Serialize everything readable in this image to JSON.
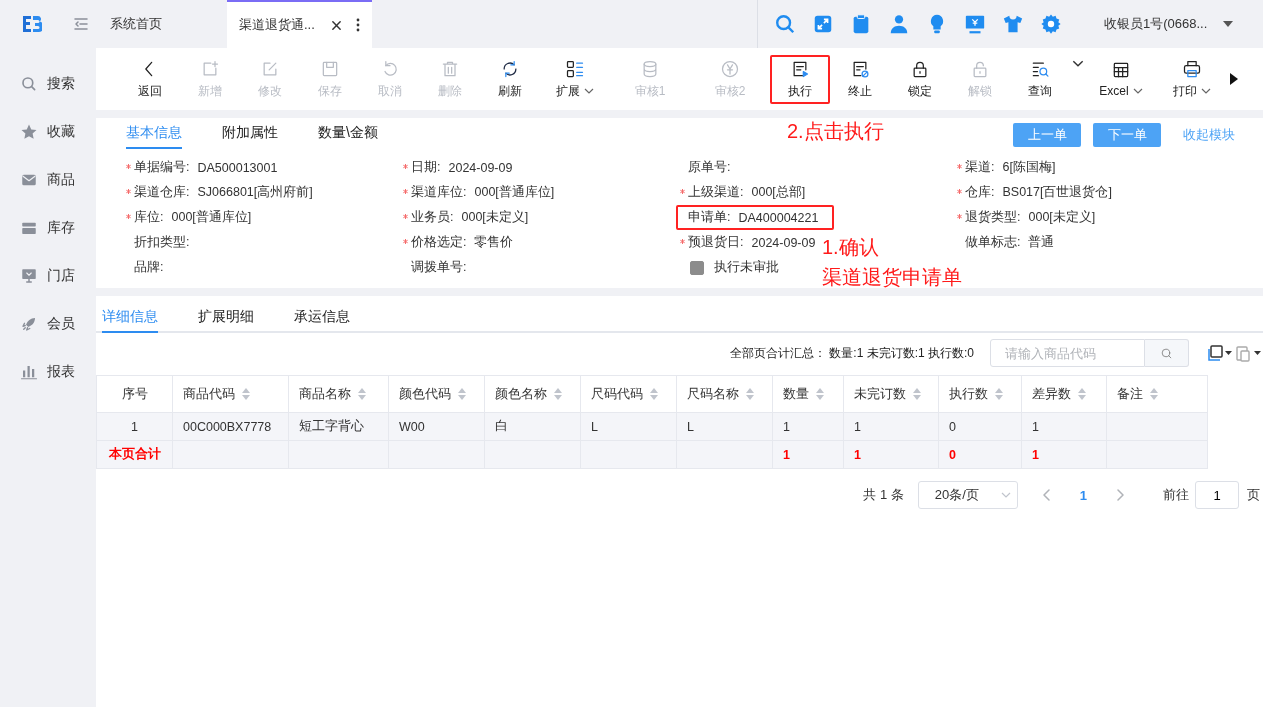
{
  "header": {
    "tabs": [
      {
        "label": "系统首页",
        "selected": false,
        "closable": false
      },
      {
        "label": "渠道退货通...",
        "selected": true,
        "closable": true
      }
    ],
    "user": "收银员1号(0668..."
  },
  "sidebar": {
    "items": [
      {
        "label": "搜索"
      },
      {
        "label": "收藏"
      },
      {
        "label": "商品"
      },
      {
        "label": "库存"
      },
      {
        "label": "门店"
      },
      {
        "label": "会员"
      },
      {
        "label": "报表"
      }
    ]
  },
  "toolbar": [
    {
      "kind": "button",
      "label": "返回",
      "disabled": false,
      "dropdown": false,
      "annotated": false
    },
    {
      "kind": "button",
      "label": "新增",
      "disabled": true,
      "dropdown": false,
      "annotated": false
    },
    {
      "kind": "button",
      "label": "修改",
      "disabled": true,
      "dropdown": false,
      "annotated": false
    },
    {
      "kind": "button",
      "label": "保存",
      "disabled": true,
      "dropdown": false,
      "annotated": false
    },
    {
      "kind": "button",
      "label": "取消",
      "disabled": true,
      "dropdown": false,
      "annotated": false
    },
    {
      "kind": "button",
      "label": "删除",
      "disabled": true,
      "dropdown": false,
      "annotated": false
    },
    {
      "kind": "button",
      "label": "刷新",
      "disabled": false,
      "dropdown": false,
      "annotated": false
    },
    {
      "kind": "button",
      "label": "扩展",
      "disabled": false,
      "dropdown": true,
      "annotated": false
    },
    {
      "kind": "button",
      "label": "审核1",
      "disabled": true,
      "dropdown": false,
      "annotated": false
    },
    {
      "kind": "button",
      "label": "审核2",
      "disabled": true,
      "dropdown": false,
      "annotated": false
    },
    {
      "kind": "button",
      "label": "执行",
      "disabled": false,
      "dropdown": false,
      "annotated": true
    },
    {
      "kind": "button",
      "label": "终止",
      "disabled": false,
      "dropdown": false,
      "annotated": false
    },
    {
      "kind": "button",
      "label": "锁定",
      "disabled": false,
      "dropdown": false,
      "annotated": false
    },
    {
      "kind": "button",
      "label": "解锁",
      "disabled": true,
      "dropdown": false,
      "annotated": false
    },
    {
      "kind": "button",
      "label": "查询",
      "disabled": false,
      "dropdown": false,
      "annotated": false
    },
    {
      "kind": "caret",
      "disabled": false
    },
    {
      "kind": "button",
      "label": "Excel",
      "disabled": false,
      "dropdown": true,
      "annotated": false
    },
    {
      "kind": "button",
      "label": "打印",
      "disabled": false,
      "dropdown": true,
      "annotated": false
    }
  ],
  "form": {
    "tabs": [
      {
        "label": "基本信息",
        "selected": true
      },
      {
        "label": "附加属性",
        "selected": false
      },
      {
        "label": "数量\\金额",
        "selected": false
      }
    ],
    "nav_buttons": [
      "上一单",
      "下一单"
    ],
    "collapse_link": "收起模块",
    "fields": [
      {
        "kind": "field",
        "label": "单据编号:",
        "value": "DA500013001",
        "required": true,
        "annotated": false
      },
      {
        "kind": "field",
        "label": "日期:",
        "value": "2024-09-09",
        "required": true,
        "annotated": false
      },
      {
        "kind": "field",
        "label": "原单号:",
        "required": false,
        "annotated": false
      },
      {
        "kind": "field",
        "label": "渠道:",
        "value": "6[陈国梅]",
        "required": true,
        "annotated": false
      },
      {
        "kind": "field",
        "label": "渠道仓库:",
        "value": "SJ066801[高州府前]",
        "required": true,
        "annotated": false
      },
      {
        "kind": "field",
        "label": "渠道库位:",
        "value": "000[普通库位]",
        "required": true,
        "annotated": false
      },
      {
        "kind": "field",
        "label": "上级渠道:",
        "value": "000[总部]",
        "required": true,
        "annotated": false
      },
      {
        "kind": "field",
        "label": "仓库:",
        "value": "BS017[百世退货仓]",
        "required": true,
        "annotated": false
      },
      {
        "kind": "field",
        "label": "库位:",
        "value": "000[普通库位]",
        "required": true,
        "annotated": false
      },
      {
        "kind": "field",
        "label": "业务员:",
        "value": "000[未定义]",
        "required": true,
        "annotated": false
      },
      {
        "kind": "field",
        "label": "申请单:",
        "value": "DA400004221",
        "required": false,
        "annotated": true
      },
      {
        "kind": "field",
        "label": "退货类型:",
        "value": "000[未定义]",
        "required": true,
        "annotated": false
      },
      {
        "kind": "field",
        "label": "折扣类型:",
        "required": false,
        "annotated": false
      },
      {
        "kind": "field",
        "label": "价格选定:",
        "value": "零售价",
        "required": true,
        "annotated": false
      },
      {
        "kind": "field",
        "label": "预退货日:",
        "value": "2024-09-09",
        "required": true,
        "annotated": false
      },
      {
        "kind": "field",
        "label": "做单标志:",
        "value": "普通",
        "required": false,
        "annotated": false
      },
      {
        "kind": "field",
        "label": "品牌:",
        "required": false,
        "annotated": false
      },
      {
        "kind": "field",
        "label": "调拨单号:",
        "required": false,
        "annotated": false
      },
      {
        "kind": "checkbox",
        "label": "执行未审批",
        "checked": false,
        "disabled": true
      }
    ]
  },
  "detail": {
    "tabs": [
      {
        "label": "详细信息",
        "selected": true
      },
      {
        "label": "扩展明细",
        "selected": false
      },
      {
        "label": "承运信息",
        "selected": false
      }
    ],
    "summary": "全部页合计汇总： 数量:1 未完订数:1 执行数:0",
    "search": {
      "placeholder": "请输入商品代码"
    },
    "table": {
      "columns": [
        {
          "label": "序号",
          "sortable": false
        },
        {
          "label": "商品代码",
          "sortable": true
        },
        {
          "label": "商品名称",
          "sortable": true
        },
        {
          "label": "颜色代码",
          "sortable": true
        },
        {
          "label": "颜色名称",
          "sortable": true
        },
        {
          "label": "尺码代码",
          "sortable": true
        },
        {
          "label": "尺码名称",
          "sortable": true
        },
        {
          "label": "数量",
          "sortable": true,
          "total": "1"
        },
        {
          "label": "未完订数",
          "sortable": true,
          "total": "1"
        },
        {
          "label": "执行数",
          "sortable": true,
          "total": "0"
        },
        {
          "label": "差异数",
          "sortable": true,
          "total": "1"
        },
        {
          "label": "备注",
          "sortable": true
        }
      ],
      "rows": [
        [
          "1",
          "00C000BX7778",
          "短工字背心",
          "W00",
          "白",
          "L",
          "L",
          "1",
          "1",
          "0",
          "1"
        ]
      ],
      "total_label": "本页合计"
    },
    "pagination": {
      "total": "共 1 条",
      "page_size": "20条/页",
      "pages": [
        {
          "label": "1",
          "selected": true
        }
      ],
      "goto_label": "前往",
      "goto_value": "1",
      "page_unit": "页"
    }
  },
  "annotations": [
    {
      "lines": [
        "2.点击执行"
      ]
    },
    {
      "lines": [
        "1.确认",
        "渠道退货申请单"
      ]
    }
  ]
}
